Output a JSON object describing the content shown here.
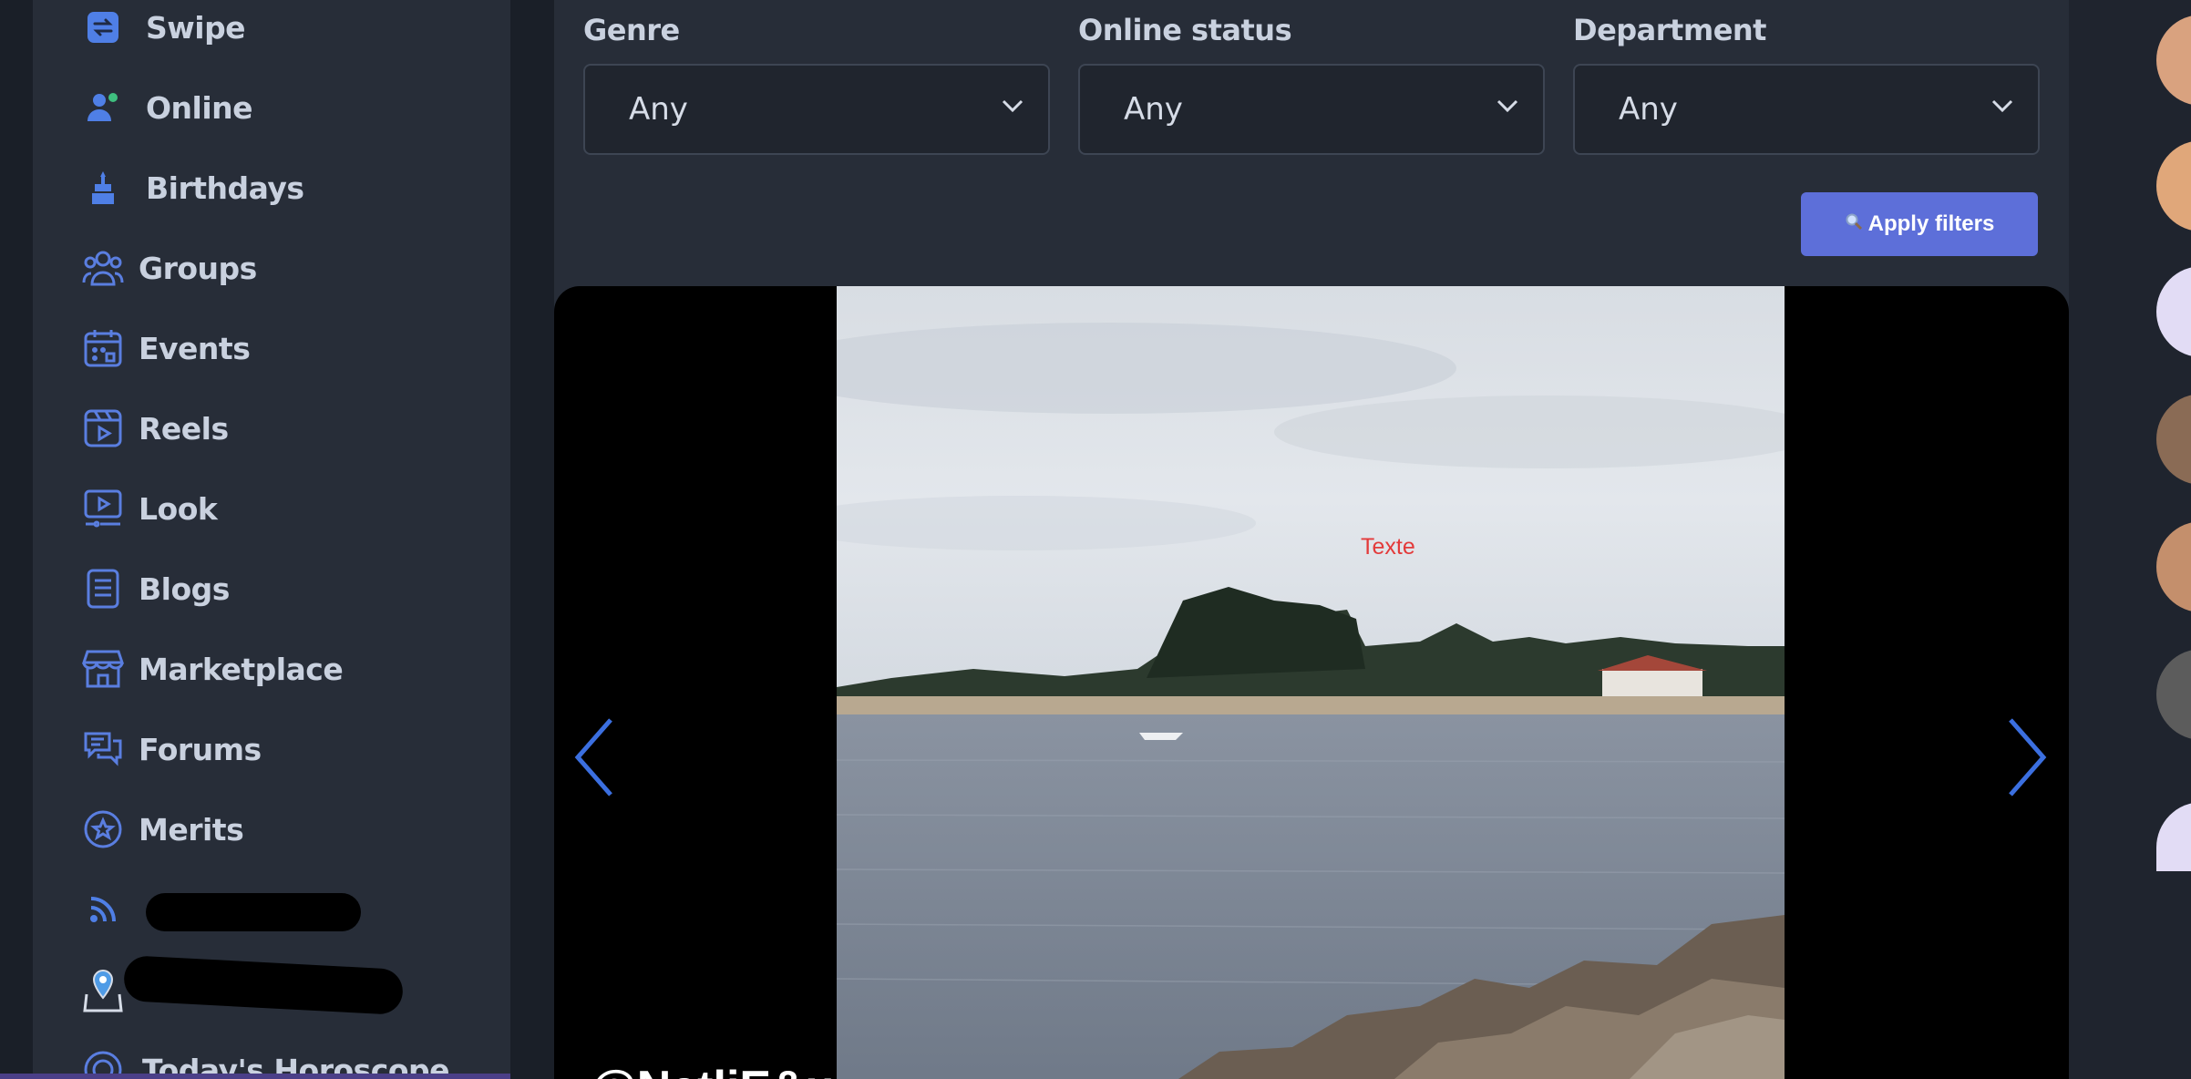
{
  "sidebar": {
    "items": [
      {
        "label": "Swipe",
        "icon": "swipe-icon"
      },
      {
        "label": "Online",
        "icon": "online-users-icon"
      },
      {
        "label": "Birthdays",
        "icon": "birthday-cake-icon"
      },
      {
        "label": "Groups",
        "icon": "groups-icon"
      },
      {
        "label": "Events",
        "icon": "calendar-icon"
      },
      {
        "label": "Reels",
        "icon": "reels-icon"
      },
      {
        "label": "Look",
        "icon": "monitor-icon"
      },
      {
        "label": "Blogs",
        "icon": "document-icon"
      },
      {
        "label": "Marketplace",
        "icon": "store-icon"
      },
      {
        "label": "Forums",
        "icon": "forum-chat-icon"
      },
      {
        "label": "Merits",
        "icon": "merit-star-icon"
      },
      {
        "label": "",
        "icon": "rss-icon"
      },
      {
        "label": "",
        "icon": "map-pin-icon"
      },
      {
        "label": "Today's Horoscope",
        "icon": "horoscope-icon"
      }
    ]
  },
  "filters": {
    "genre": {
      "label": "Genre",
      "value": "Any"
    },
    "online_status": {
      "label": "Online status",
      "value": "Any"
    },
    "department": {
      "label": "Department",
      "value": "Any"
    },
    "apply_label": "Apply filters"
  },
  "carousel": {
    "overlay_text": "Texte",
    "caption": "@NatliE&u...",
    "accent": "#3b6fe0"
  },
  "colors": {
    "icon_blue": "#4f7fe6",
    "button": "#5d6fd9"
  }
}
